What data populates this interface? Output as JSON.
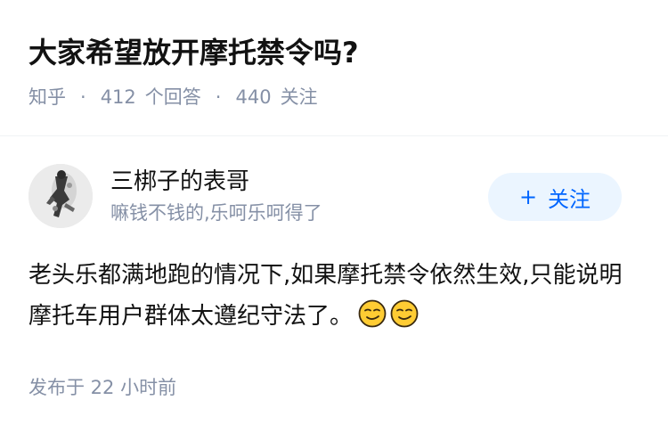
{
  "question": {
    "title": "大家希望放开摩托禁令吗?",
    "source": "知乎",
    "separator": "·",
    "answer_count": "412",
    "answer_label": "个回答",
    "follower_count": "440",
    "follower_label": "关注"
  },
  "author": {
    "name": "三梆子的表哥",
    "headline": "嘛钱不钱的,乐呵乐呵得了",
    "follow_label": "关注",
    "follow_plus": "+"
  },
  "answer": {
    "text": "老头乐都满地跑的情况下,如果摩托禁令依然生效,只能说明摩托车用户群体太遵纪守法了。",
    "emojis": [
      "smirk-emoji",
      "smirk-emoji"
    ]
  },
  "footer": {
    "publish_time": "发布于 22 小时前"
  },
  "colors": {
    "title": "#121212",
    "meta": "#8590a6",
    "follow_bg": "#ebf5ff",
    "follow_text": "#0066ff",
    "emoji": "#ffcc33"
  }
}
